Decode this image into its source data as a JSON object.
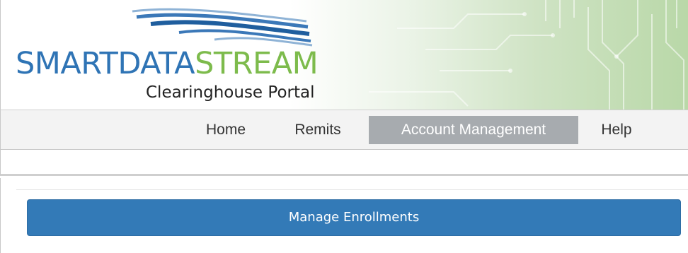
{
  "header": {
    "brand_part1": "SMARTDATA",
    "brand_part2": "STREAM",
    "subtitle": "Clearinghouse Portal"
  },
  "nav": {
    "items": [
      {
        "label": "Home",
        "active": false
      },
      {
        "label": "Remits",
        "active": false
      },
      {
        "label": "Account Management",
        "active": true
      },
      {
        "label": "Help",
        "active": false
      }
    ]
  },
  "main": {
    "manage_enrollments_label": "Manage Enrollments"
  },
  "colors": {
    "brand_blue": "#2f74b5",
    "brand_green": "#7dbb4c",
    "nav_active": "#a7abaf",
    "button_primary": "#337ab7"
  }
}
